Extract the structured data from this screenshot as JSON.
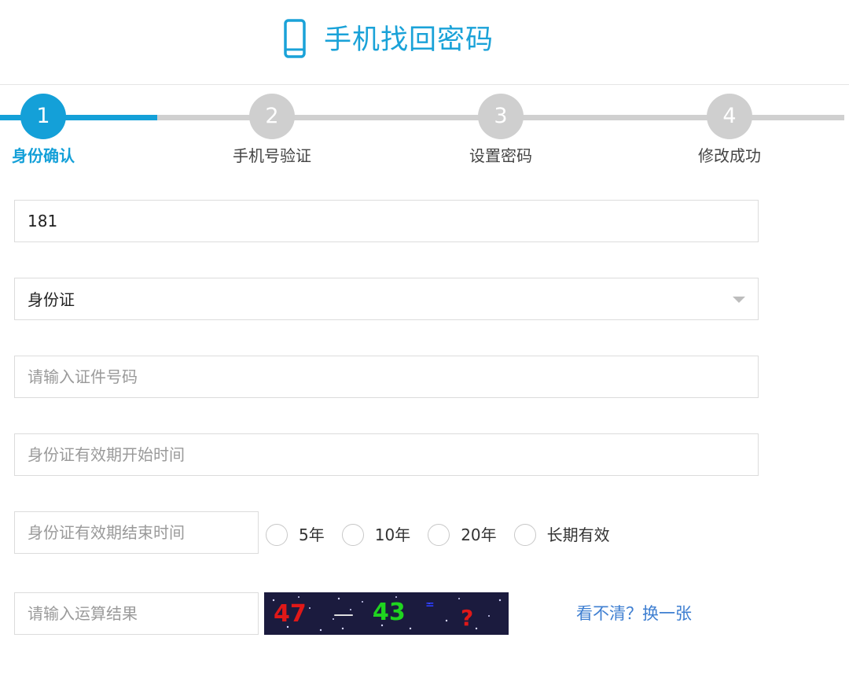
{
  "header": {
    "title": "手机找回密码",
    "icon": "mobile-phone-icon",
    "accent_color": "#1aa2d8"
  },
  "steps": [
    {
      "number": "1",
      "label": "身份确认",
      "active": true
    },
    {
      "number": "2",
      "label": "手机号验证",
      "active": false
    },
    {
      "number": "3",
      "label": "设置密码",
      "active": false
    },
    {
      "number": "4",
      "label": "修改成功",
      "active": false
    }
  ],
  "form": {
    "phone_value": "181",
    "id_type_selected": "身份证",
    "id_number_placeholder": "请输入证件号码",
    "valid_start_placeholder": "身份证有效期开始时间",
    "valid_end_placeholder": "身份证有效期结束时间",
    "validity_options": [
      "5年",
      "10年",
      "20年",
      "长期有效"
    ],
    "captcha_placeholder": "请输入运算结果",
    "captcha_text": {
      "left_operand": "47",
      "operator": "—",
      "right_operand": "43",
      "equals_mark": "=",
      "question": "?"
    },
    "refresh_link": "看不清？换一张"
  },
  "colors": {
    "active": "#14a0d8",
    "inactive": "#cfcfcf",
    "link": "#3f7fd1",
    "captcha_bg": "#1b1b3e"
  }
}
